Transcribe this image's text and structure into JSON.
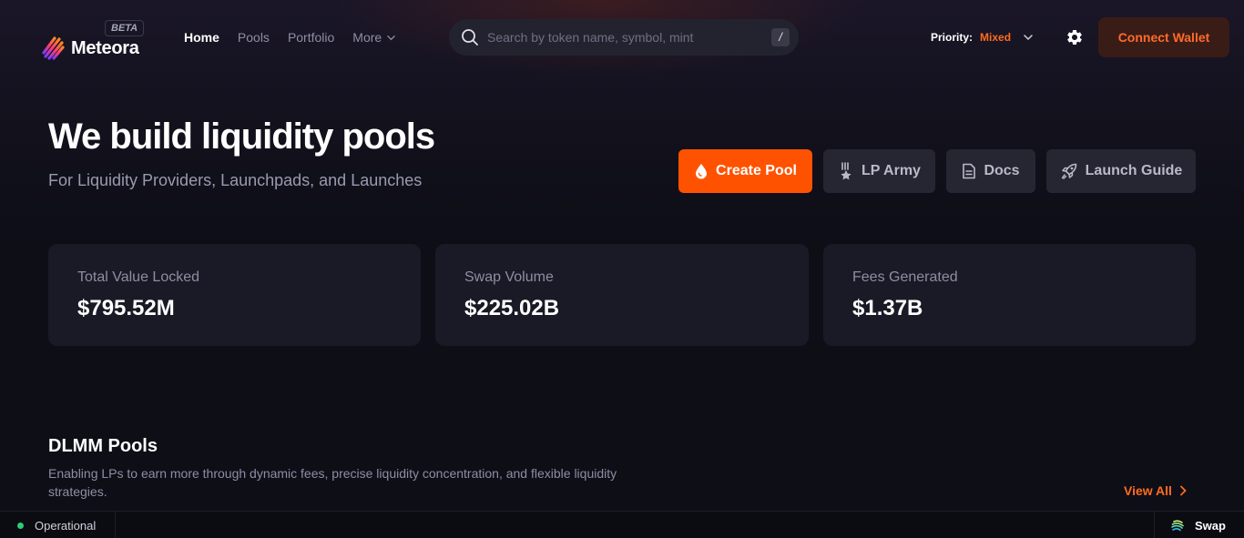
{
  "header": {
    "logo_text": "Meteora",
    "beta_badge": "BETA",
    "nav": [
      {
        "label": "Home",
        "active": true
      },
      {
        "label": "Pools",
        "active": false
      },
      {
        "label": "Portfolio",
        "active": false
      },
      {
        "label": "More",
        "active": false
      }
    ],
    "search": {
      "placeholder": "Search by token name, symbol, mint",
      "shortcut": "/"
    },
    "priority": {
      "label": "Priority:",
      "value": "Mixed"
    },
    "connect_wallet": "Connect Wallet",
    "settings_icon": "gear-icon"
  },
  "hero": {
    "title": "We build liquidity pools",
    "subtitle": "For Liquidity Providers, Launchpads, and Launches",
    "buttons": [
      {
        "label": "Create Pool",
        "icon": "droplet-icon"
      },
      {
        "label": "LP Army",
        "icon": "medal-icon"
      },
      {
        "label": "Docs",
        "icon": "document-icon"
      },
      {
        "label": "Launch Guide",
        "icon": "rocket-icon"
      }
    ]
  },
  "stats": [
    {
      "label": "Total Value Locked",
      "value": "$795.52M"
    },
    {
      "label": "Swap Volume",
      "value": "$225.02B"
    },
    {
      "label": "Fees Generated",
      "value": "$1.37B"
    }
  ],
  "dlmm": {
    "title": "DLMM Pools",
    "description": "Enabling LPs to earn more through dynamic fees, precise liquidity concentration, and flexible liquidity strategies.",
    "view_all": "View All"
  },
  "statusbar": {
    "status": "Operational",
    "swap": "Swap"
  },
  "colors": {
    "accent": "#ff5200",
    "accent_text": "#ff6b1f",
    "background": "#0e0e17",
    "card": "#1a1a26",
    "status_ok": "#2ecc71"
  }
}
